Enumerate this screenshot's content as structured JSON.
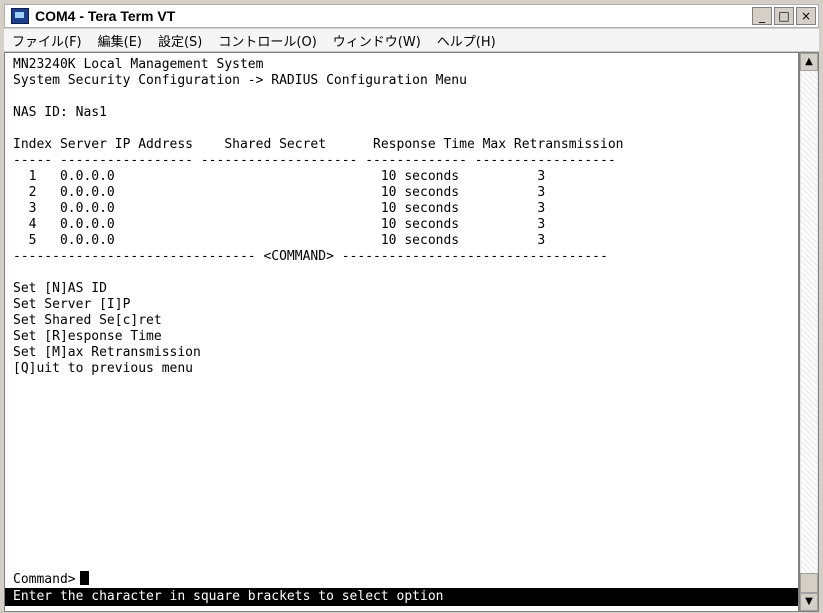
{
  "window": {
    "title": "COM4 - Tera Term VT"
  },
  "controls": {
    "minimize": "_",
    "maximize": "□",
    "close": "×"
  },
  "menu": [
    "ファイル(F)",
    "編集(E)",
    "設定(S)",
    "コントロール(O)",
    "ウィンドウ(W)",
    "ヘルプ(H)"
  ],
  "terminal": {
    "lines": [
      "MN23240K Local Management System",
      "System Security Configuration -> RADIUS Configuration Menu",
      "",
      "NAS ID: Nas1",
      "",
      "Index Server IP Address    Shared Secret      Response Time Max Retransmission",
      "----- ----------------- -------------------- ------------- ------------------",
      "  1   0.0.0.0                                  10 seconds          3",
      "  2   0.0.0.0                                  10 seconds          3",
      "  3   0.0.0.0                                  10 seconds          3",
      "  4   0.0.0.0                                  10 seconds          3",
      "  5   0.0.0.0                                  10 seconds          3",
      "------------------------------- <COMMAND> ----------------------------------",
      "",
      "Set [N]AS ID",
      "Set Server [I]P",
      "Set Shared Se[c]ret",
      "Set [R]esponse Time",
      "Set [M]ax Retransmission",
      "[Q]uit to previous menu",
      "",
      "",
      "Command>"
    ],
    "status": "Enter the character in square brackets to select option"
  },
  "scroll": {
    "up": "▲",
    "down": "▼"
  }
}
